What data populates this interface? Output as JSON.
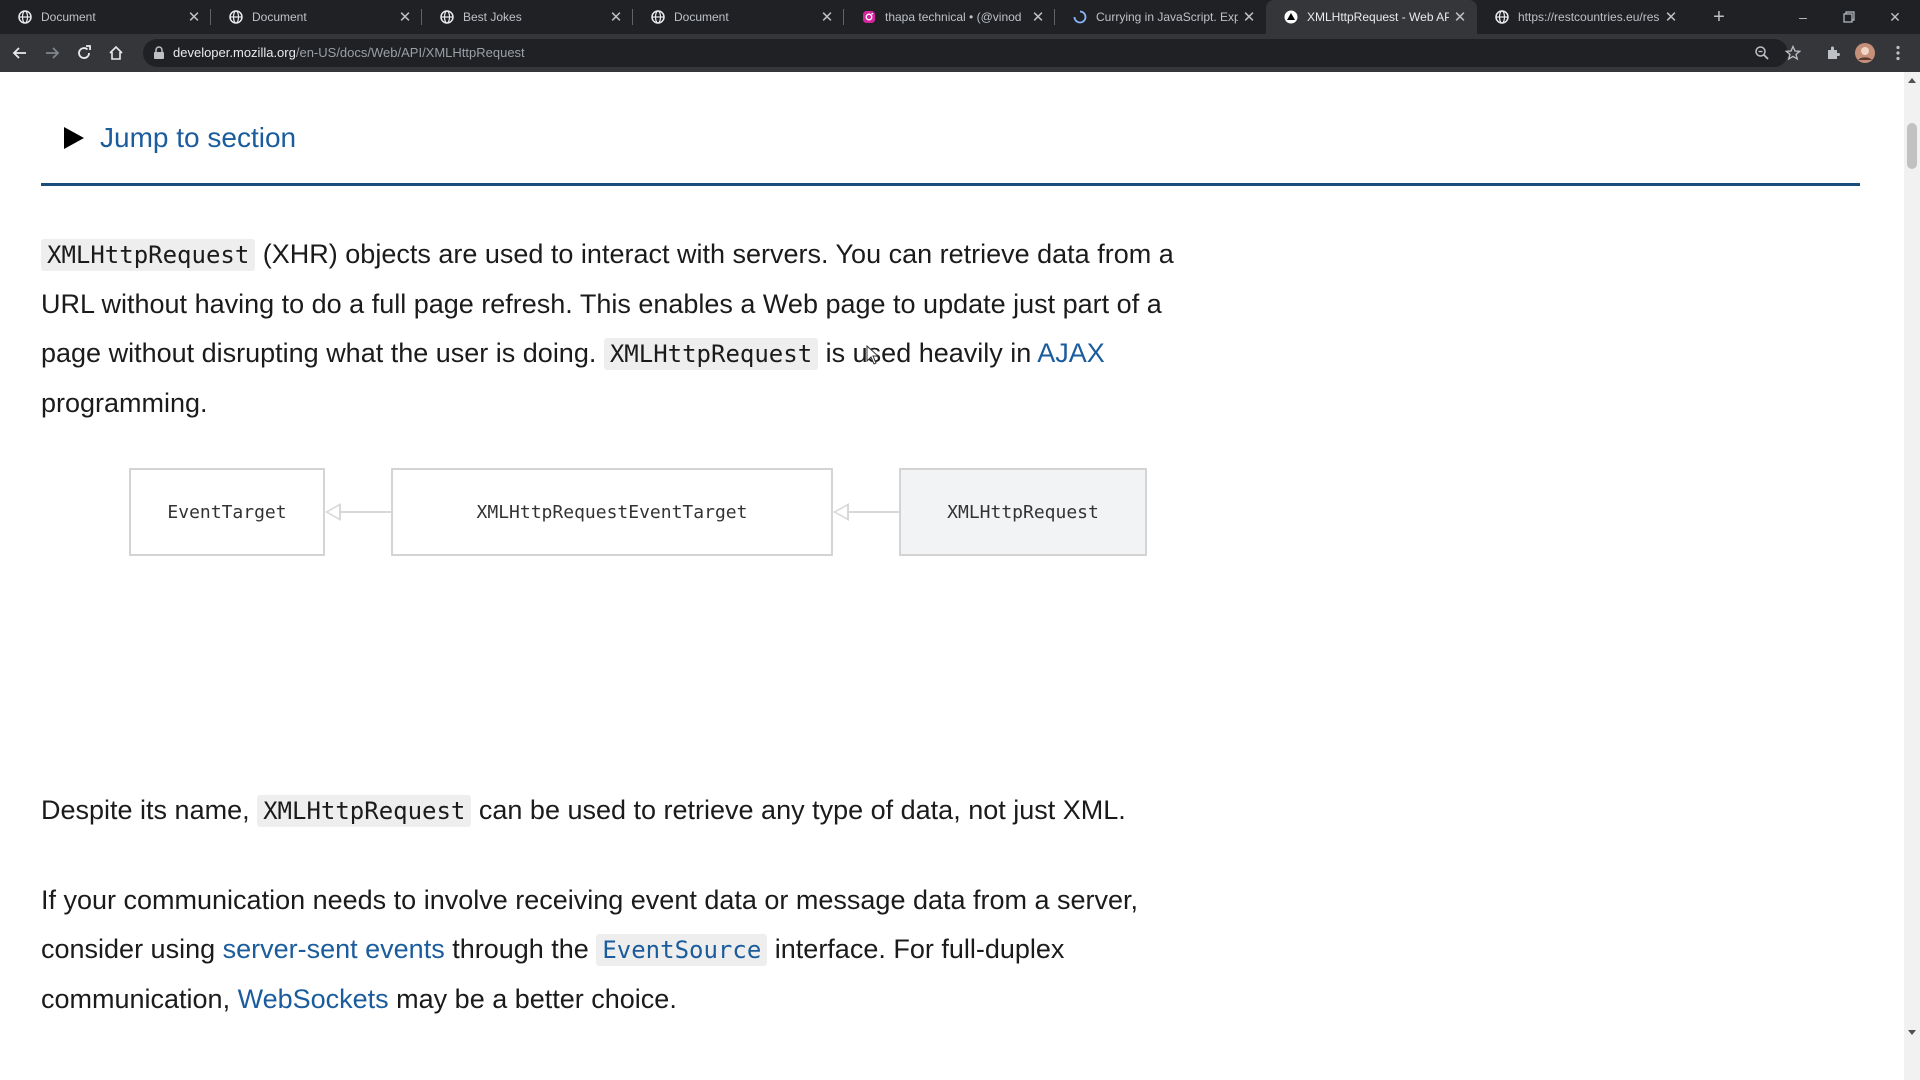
{
  "tabs": [
    {
      "title": "Document",
      "favicon": "globe-icon"
    },
    {
      "title": "Document",
      "favicon": "globe-icon"
    },
    {
      "title": "Best Jokes",
      "favicon": "globe-icon"
    },
    {
      "title": "Document",
      "favicon": "globe-icon"
    },
    {
      "title": "thapa technical • (@vinod",
      "favicon": "instagram-icon"
    },
    {
      "title": "Currying in JavaScript. Expla",
      "favicon": "loading-icon"
    },
    {
      "title": "XMLHttpRequest - Web API",
      "favicon": "mdn-icon"
    },
    {
      "title": "https://restcountries.eu/res",
      "favicon": "globe-icon"
    }
  ],
  "active_tab_index": 6,
  "address_bar": {
    "host": "developer.mozilla.org",
    "path": "/en-US/docs/Web/API/XMLHttpRequest"
  },
  "page": {
    "jump_to_section": "Jump to section",
    "intro": {
      "code1": "XMLHttpRequest",
      "text1": " (XHR) objects are used to interact with servers. You can retrieve data from a URL without having to do a full page refresh. This enables a Web page to update just part of a page without disrupting what the user is doing. ",
      "code2": "XMLHttpRequest",
      "text2": " is used heavily in ",
      "link_ajax": "AJAX",
      "text3": " programming."
    },
    "diagram": {
      "box1": "EventTarget",
      "box2": "XMLHttpRequestEventTarget",
      "box3": "XMLHttpRequest"
    },
    "despite": {
      "text1": "Despite its name, ",
      "code": "XMLHttpRequest",
      "text2": " can be used to retrieve any type of data, not just XML."
    },
    "comm": {
      "text1": "If your communication needs to involve receiving event data or message data from a server, consider using ",
      "link_sse": "server-sent events",
      "text2": " through the ",
      "code_link": "EventSource",
      "text3": " interface. For full-duplex communication, ",
      "link_ws": "WebSockets",
      "text4": " may be a better choice."
    }
  },
  "colors": {
    "link": "#1a5c9c",
    "rule": "#1a4d7c",
    "tabstrip": "#202124",
    "toolbar": "#35363a"
  }
}
